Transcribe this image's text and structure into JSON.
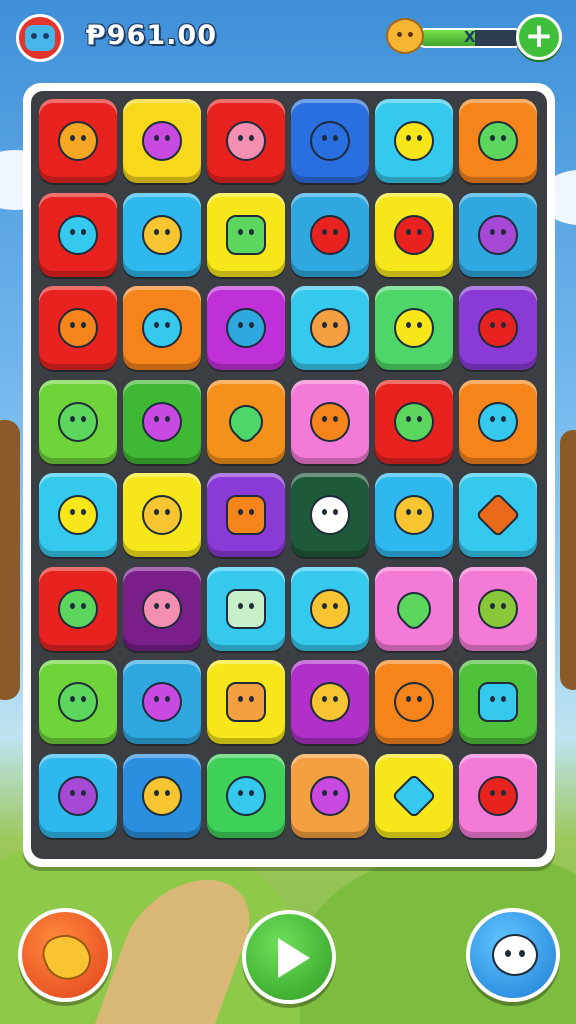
{
  "header": {
    "score": "Ᵽ961.00",
    "energy_label": "X",
    "energy_fraction": 0.55,
    "plus_label": "+"
  },
  "board": {
    "rows": 8,
    "cols": 6,
    "tiles": [
      [
        "#e8231f",
        "#f7d81a",
        "#e8231f",
        "#2a6fe0",
        "#35c9ee",
        "#f5841a"
      ],
      [
        "#e8231f",
        "#2fb8ee",
        "#f7e61a",
        "#2fa8e0",
        "#f7e61a",
        "#2fa8e0"
      ],
      [
        "#e8231f",
        "#f5841a",
        "#c030d8",
        "#35c9ee",
        "#4fd66a",
        "#8a3ad6"
      ],
      [
        "#6ed43a",
        "#3fb834",
        "#f5901a",
        "#f47ad8",
        "#e8231f",
        "#f5841a"
      ],
      [
        "#35c9ee",
        "#f7e61a",
        "#8a3ad6",
        "#1e5a3a",
        "#2fb8ee",
        "#35c9ee"
      ],
      [
        "#e8231f",
        "#7a1e8a",
        "#35c9ee",
        "#35c9ee",
        "#f47ad8",
        "#f47ad8"
      ],
      [
        "#6ed43a",
        "#2fa8e0",
        "#f7e61a",
        "#b030c8",
        "#f5841a",
        "#4fc23a"
      ],
      [
        "#2fb8ee",
        "#2a8fe0",
        "#3fd05a",
        "#f5a040",
        "#f7e61a",
        "#f47ad8"
      ]
    ],
    "glyphs": [
      [
        "#f5a623",
        "#c84ae0",
        "#f48fb1",
        "#2a6fe0",
        "#f7e61a",
        "#5cd65c"
      ],
      [
        "#35c9ee",
        "#f7c531",
        "#5cd65c",
        "#e8231f",
        "#e8231f",
        "#a64ad6"
      ],
      [
        "#f5841a",
        "#35c9ee",
        "#2fa8e0",
        "#f5a040",
        "#f7e61a",
        "#e8231f"
      ],
      [
        "#5cd65c",
        "#c84ae0",
        "#4fd66a",
        "#f5841a",
        "#5cd65c",
        "#35c9ee"
      ],
      [
        "#f7e61a",
        "#f7c531",
        "#f5841a",
        "#ffffff",
        "#f7c531",
        "#e86a1a"
      ],
      [
        "#5cd65c",
        "#f48fb1",
        "#c8f0c8",
        "#f7c531",
        "#5cd65c",
        "#8ac83a"
      ],
      [
        "#5cd65c",
        "#c84ae0",
        "#f5a040",
        "#f7c531",
        "#f5841a",
        "#35c9ee"
      ],
      [
        "#a64ad6",
        "#f7c531",
        "#35c9ee",
        "#c84ae0",
        "#35c9ee",
        "#e8231f"
      ]
    ],
    "shapes": [
      [
        "round",
        "round",
        "round",
        "round",
        "round",
        "round"
      ],
      [
        "round",
        "round",
        "sq",
        "round",
        "round",
        "round"
      ],
      [
        "round",
        "round",
        "round",
        "round",
        "round",
        "round"
      ],
      [
        "round",
        "round",
        "heart",
        "round",
        "round",
        "round"
      ],
      [
        "round",
        "round",
        "sq",
        "round",
        "round",
        "dia"
      ],
      [
        "round",
        "round",
        "sq",
        "round",
        "heart",
        "round"
      ],
      [
        "round",
        "round",
        "sq",
        "round",
        "round",
        "sq"
      ],
      [
        "round",
        "round",
        "round",
        "round",
        "dia",
        "round"
      ]
    ]
  },
  "icons": {
    "avatar": "monster-avatar-icon",
    "energy": "creature-energy-icon",
    "boost": "gem-boost-icon",
    "play": "play-icon",
    "pet": "pet-face-icon"
  }
}
